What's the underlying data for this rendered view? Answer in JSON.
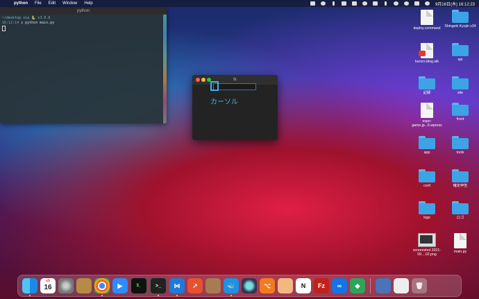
{
  "menubar": {
    "app_name": "python",
    "items": [
      "File",
      "Edit",
      "Window",
      "Help"
    ],
    "clock": "9月16日(木) 16:12:23"
  },
  "terminal": {
    "title": "python",
    "line1_path": "~/desktop via",
    "line1_version": "v3.8.6",
    "line2_time": "16:12:14",
    "line2_cmd": "python main.py"
  },
  "tk_window": {
    "title": "tk",
    "label": "カーソル"
  },
  "desktop_icons": [
    {
      "label": "deploy.command",
      "type": "doc"
    },
    {
      "label": "Shingeki Kyojin v34",
      "type": "folder"
    },
    {
      "label": "kuroro.blog.stk",
      "type": "doc-red"
    },
    {
      "label": "api",
      "type": "folder"
    },
    {
      "label": "記録",
      "type": "folder"
    },
    {
      "label": "site",
      "type": "folder"
    },
    {
      "label": "espo-game.jp...6.wpress",
      "type": "doc"
    },
    {
      "label": "front",
      "type": "folder"
    },
    {
      "label": "app",
      "type": "folder"
    },
    {
      "label": "tools",
      "type": "folder"
    },
    {
      "label": "conf",
      "type": "folder"
    },
    {
      "label": "確定申告",
      "type": "folder"
    },
    {
      "label": "logs",
      "type": "folder"
    },
    {
      "label": "ロゴ",
      "type": "folder"
    },
    {
      "label": "screenshot 2021-09....02.png",
      "type": "shot"
    },
    {
      "label": "main.py",
      "type": "doc"
    }
  ],
  "dock": {
    "calendar_month": "9月",
    "calendar_day": "16",
    "colors": {
      "finder": "#1e88e5",
      "settings": "#888888",
      "chrome": "#ffffff",
      "zoom": "#2d8cff",
      "vscode": "#1f7ad8",
      "docker": "#1d91e6",
      "notion": "#ffffff",
      "filezilla": "#c0221a",
      "accent": "#3fb8ee"
    }
  }
}
